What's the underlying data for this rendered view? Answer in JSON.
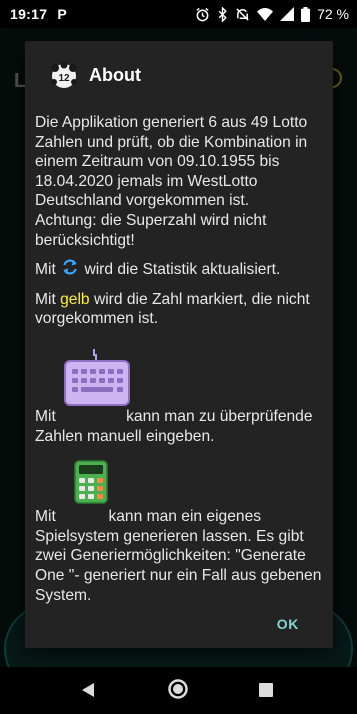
{
  "status_bar": {
    "time": "19:17",
    "notification_letter": "P",
    "battery_percent": "72 %"
  },
  "background_app": {
    "title_initial": "L"
  },
  "app_icon": {
    "number": "12"
  },
  "dialog": {
    "title": "About",
    "paragraph_1": "Die Applikation generiert 6 aus 49 Lotto Zahlen und prüft, ob die Kombination in einem Zeitraum von 09.10.1955 bis 18.04.2020 jemals im WestLotto Deutschland vorgekommen ist.",
    "paragraph_2": "Achtung: die Superzahl wird nicht berücksichtigt!",
    "refresh_prefix": "Mit ",
    "refresh_suffix": " wird die Statistik aktualisiert.",
    "yellow_prefix": "Mit ",
    "yellow_word": "gelb",
    "yellow_suffix": " wird die Zahl markiert, die nicht vorgekommen ist.",
    "keyboard_prefix": "Mit",
    "keyboard_suffix": " kann man zu überprüfende Zahlen manuell eingeben.",
    "calc_prefix": "Mit ",
    "calc_suffix": " kann man ein eigenes Spielsystem generieren lassen. Es gibt zwei Generiermöglichkeiten: \"Generate One \"- generiert nur ein Fall aus gebenen System.",
    "ok_label": "OK"
  },
  "colors": {
    "highlight": "#ffee3a",
    "accent": "#7fd6cf",
    "dialog_bg": "#232323"
  },
  "icons": [
    "alarm-icon",
    "bluetooth-icon",
    "mute-icon",
    "wifi-icon",
    "signal-icon",
    "battery-icon",
    "refresh-icon",
    "keyboard-icon",
    "calculator-icon"
  ]
}
